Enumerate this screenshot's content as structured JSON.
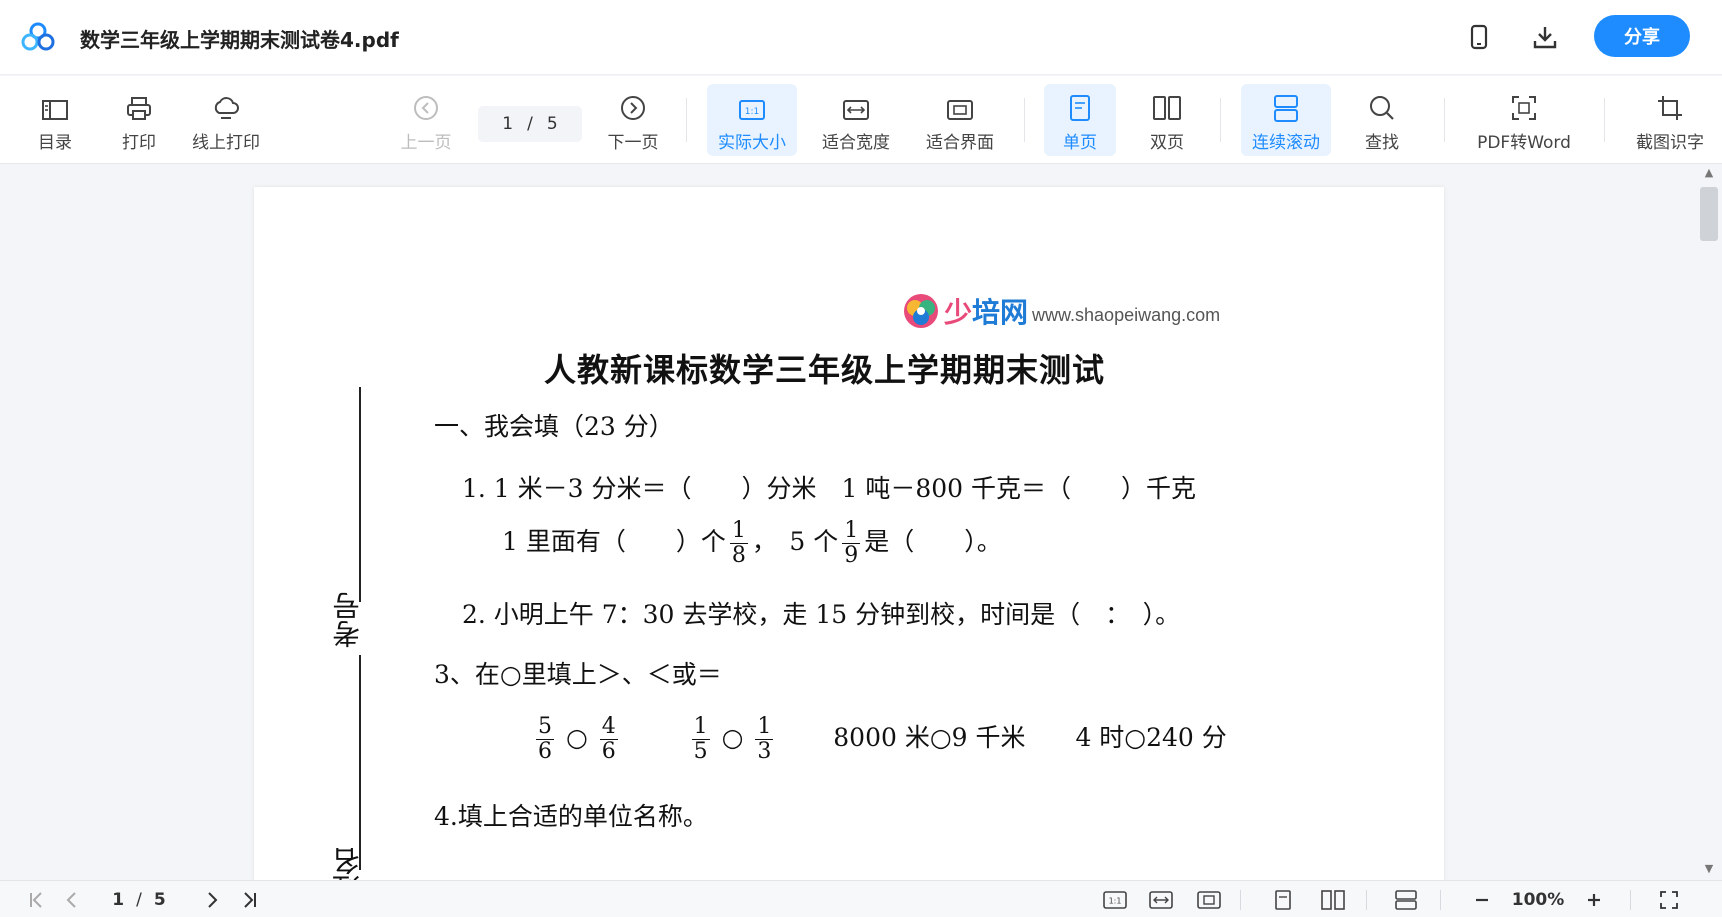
{
  "titlebar": {
    "title": "数学三年级上学期期末测试卷4.pdf",
    "share_label": "分享",
    "icons": [
      "app-logo-icon",
      "phone-icon",
      "download-icon"
    ]
  },
  "toolbar": {
    "toc_label": "目录",
    "print_label": "打印",
    "online_print_label": "线上打印",
    "prev_label": "上一页",
    "current_page": "1",
    "page_sep": "/",
    "total_pages": "5",
    "next_label": "下一页",
    "actual_size_label": "实际大小",
    "fit_width_label": "适合宽度",
    "fit_screen_label": "适合界面",
    "single_page_label": "单页",
    "double_page_label": "双页",
    "continuous_label": "连续滚动",
    "search_label": "查找",
    "pdf_word_label": "PDF转Word",
    "ocr_label": "截图识字",
    "accent": "#1e8cff"
  },
  "document": {
    "brand_cn_1": "少",
    "brand_cn_2": "培网",
    "brand_url": "www.shaopeiwang.com",
    "title": "人教新课标数学三年级上学期期末测试",
    "section1": "一、我会填（23 分）",
    "q1a": "1. 1 米－3 分米＝（　　）分米　1 吨－800 千克＝（　　）千克",
    "q1b_pre": "1 里面有（　　）个",
    "q1b_f1_num": "1",
    "q1b_f1_den": "8",
    "q1b_mid": "，　5 个",
    "q1b_f2_num": "1",
    "q1b_f2_den": "9",
    "q1b_post": "是（　　）。",
    "q2": "2. 小明上午 7：30 去学校，走 15 分钟到校，时间是（　：　）。",
    "q3": "3、在○里填上＞、＜或＝",
    "q3_items": {
      "a_num": "5",
      "a_den": "6",
      "b_num": "4",
      "b_den": "6",
      "c_num": "1",
      "c_den": "5",
      "d_num": "1",
      "d_den": "3",
      "circle": "○",
      "e": "8000 米○9 千米",
      "f": "4 时○240 分"
    },
    "q4": "4.填上合适的单位名称。",
    "margin_kaohao": "考号",
    "margin_xingming": "姓名"
  },
  "bottombar": {
    "current_page": "1",
    "page_sep": "/",
    "total_pages": "5",
    "zoom": "100%"
  }
}
